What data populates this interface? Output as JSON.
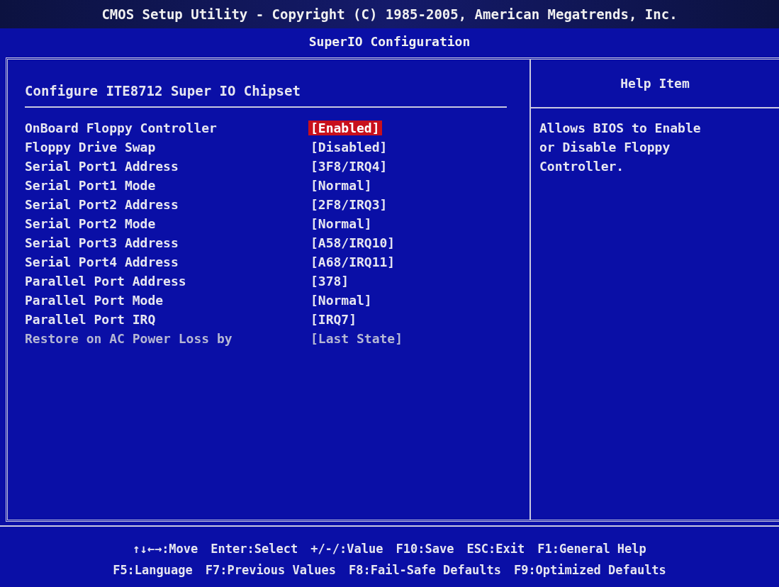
{
  "window": {
    "title": "CMOS Setup Utility - Copyright (C) 1985-2005, American Megatrends, Inc.",
    "subtitle": "SuperIO Configuration"
  },
  "panel": {
    "heading": "Configure ITE8712 Super IO Chipset"
  },
  "settings": [
    {
      "label": "OnBoard Floppy Controller",
      "value": "[Enabled]",
      "selected": true,
      "disabled": false
    },
    {
      "label": "Floppy Drive Swap",
      "value": "[Disabled]",
      "selected": false,
      "disabled": false
    },
    {
      "label": "Serial Port1 Address",
      "value": "[3F8/IRQ4]",
      "selected": false,
      "disabled": false
    },
    {
      "label": "Serial Port1 Mode",
      "value": "[Normal]",
      "selected": false,
      "disabled": false
    },
    {
      "label": "Serial Port2 Address",
      "value": "[2F8/IRQ3]",
      "selected": false,
      "disabled": false
    },
    {
      "label": "Serial Port2 Mode",
      "value": "[Normal]",
      "selected": false,
      "disabled": false
    },
    {
      "label": "Serial Port3 Address",
      "value": "[A58/IRQ10]",
      "selected": false,
      "disabled": false
    },
    {
      "label": "Serial Port4 Address",
      "value": "[A68/IRQ11]",
      "selected": false,
      "disabled": false
    },
    {
      "label": "Parallel Port Address",
      "value": "[378]",
      "selected": false,
      "disabled": false
    },
    {
      "label": "Parallel Port Mode",
      "value": "[Normal]",
      "selected": false,
      "disabled": false
    },
    {
      "label": "Parallel Port IRQ",
      "value": "[IRQ7]",
      "selected": false,
      "disabled": false
    },
    {
      "label": "Restore on AC Power Loss by",
      "value": "[Last State]",
      "selected": false,
      "disabled": true
    }
  ],
  "help": {
    "title": "Help Item",
    "text": "Allows BIOS to Enable or Disable Floppy Controller."
  },
  "footer": {
    "navigation_keys": [
      "↑↓←→:Move",
      "Enter:Select",
      "+/-/:Value",
      "F10:Save",
      "ESC:Exit",
      "F1:General Help"
    ],
    "function_keys": [
      "F5:Language",
      "F7:Previous Values",
      "F8:Fail-Safe Defaults",
      "F9:Optimized Defaults"
    ]
  }
}
